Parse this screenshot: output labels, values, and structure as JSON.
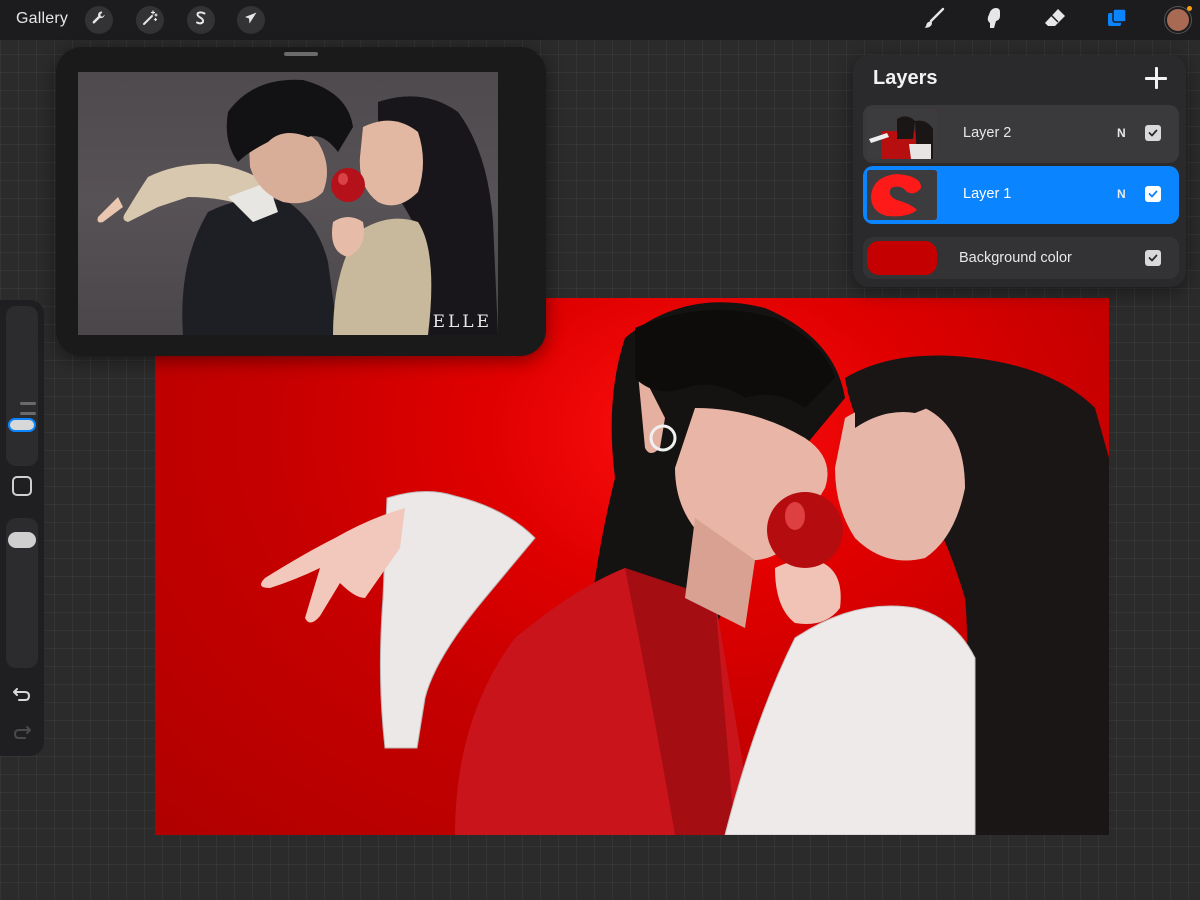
{
  "toolbar": {
    "gallery_label": "Gallery",
    "left_tools": [
      {
        "name": "actions",
        "icon": "wrench-icon"
      },
      {
        "name": "adjustments",
        "icon": "magic-wand-icon"
      },
      {
        "name": "selection",
        "icon": "selection-s-icon"
      },
      {
        "name": "transform",
        "icon": "arrow-cursor-icon"
      }
    ],
    "right_tools": [
      {
        "name": "brush",
        "icon": "brush-icon",
        "active": false
      },
      {
        "name": "smudge",
        "icon": "smudge-icon",
        "active": false
      },
      {
        "name": "eraser",
        "icon": "eraser-icon",
        "active": false
      },
      {
        "name": "layers",
        "icon": "layers-icon",
        "active": true
      }
    ],
    "current_color": "#a86a52",
    "accent_color": "#0a84ff",
    "indicator_color": "#ff9f0a"
  },
  "reference": {
    "watermark": "ELLE"
  },
  "layers": {
    "title": "Layers",
    "items": [
      {
        "name": "Layer 2",
        "blend": "N",
        "visible": true,
        "active": false
      },
      {
        "name": "Layer 1",
        "blend": "N",
        "visible": true,
        "active": true
      }
    ],
    "background": {
      "name": "Background color",
      "color": "#c40000",
      "visible": true
    }
  },
  "sidebar": {
    "undo": "undo-icon",
    "redo": "redo-icon"
  }
}
